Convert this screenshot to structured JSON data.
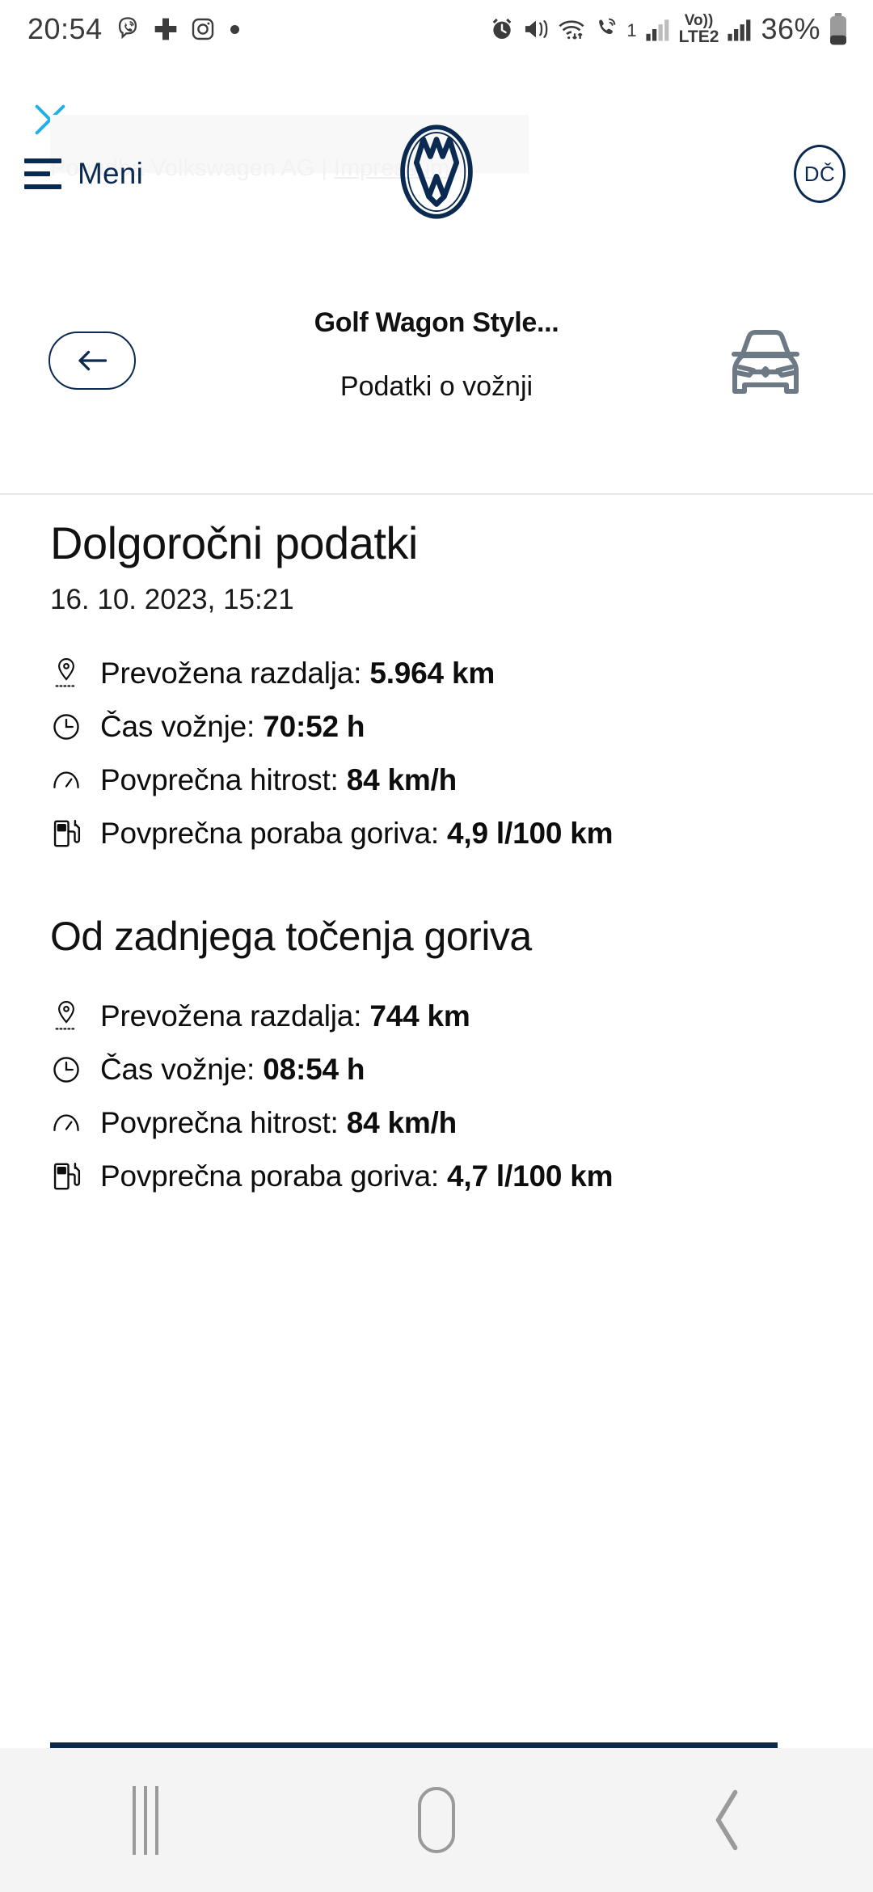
{
  "statusbar": {
    "time": "20:54",
    "left_icons": [
      "viber-icon",
      "health-cross-icon",
      "instagram-icon",
      "dot-indicator-icon"
    ],
    "right_icons": [
      "alarm-icon",
      "mute-vibrate-icon",
      "wifi-icon",
      "call-wifi-icon",
      "signal-1-icon",
      "volte-lte2-icon",
      "signal-2-icon"
    ],
    "network_label": "Vo)) LTE2",
    "sim1_label": "1",
    "battery_percent": "36%"
  },
  "browser": {
    "close_label": "close-icon",
    "close_color": "#20b1e8"
  },
  "watermark": {
    "prefix": "Ponudba Volkswagen AG | ",
    "link": "Impressum"
  },
  "topnav": {
    "menu_label": "Meni",
    "logo_label": "volkswagen-logo",
    "avatar_initials": "DČ",
    "brand_color": "#0b2a51"
  },
  "titlebar": {
    "back_label": "back-arrow",
    "vehicle_name": "Golf Wagon Style...",
    "page_subtitle": "Podatki o vožnji",
    "vehicle_icon": "car-front-icon"
  },
  "sections": [
    {
      "title": "Dolgoročni podatki",
      "date": "16. 10. 2023, 15:21",
      "rows": [
        {
          "icon": "location-pin-icon",
          "label": "Prevožena razdalja: ",
          "value": "5.964 km"
        },
        {
          "icon": "clock-icon",
          "label": "Čas vožnje: ",
          "value": "70:52 h"
        },
        {
          "icon": "speedometer-icon",
          "label": "Povprečna hitrost: ",
          "value": "84 km/h"
        },
        {
          "icon": "fuel-pump-icon",
          "label": "Povprečna poraba goriva: ",
          "value": "4,9 l/100 km"
        }
      ]
    },
    {
      "title": "Od zadnjega točenja goriva",
      "date": "",
      "rows": [
        {
          "icon": "location-pin-icon",
          "label": "Prevožena razdalja: ",
          "value": "744 km"
        },
        {
          "icon": "clock-icon",
          "label": "Čas vožnje: ",
          "value": "08:54 h"
        },
        {
          "icon": "speedometer-icon",
          "label": "Povprečna hitrost: ",
          "value": "84 km/h"
        },
        {
          "icon": "fuel-pump-icon",
          "label": "Povprečna poraba goriva: ",
          "value": "4,7 l/100 km"
        }
      ]
    }
  ],
  "navbar": {
    "recents": "recents-icon",
    "home": "home-icon",
    "back": "back-icon"
  }
}
